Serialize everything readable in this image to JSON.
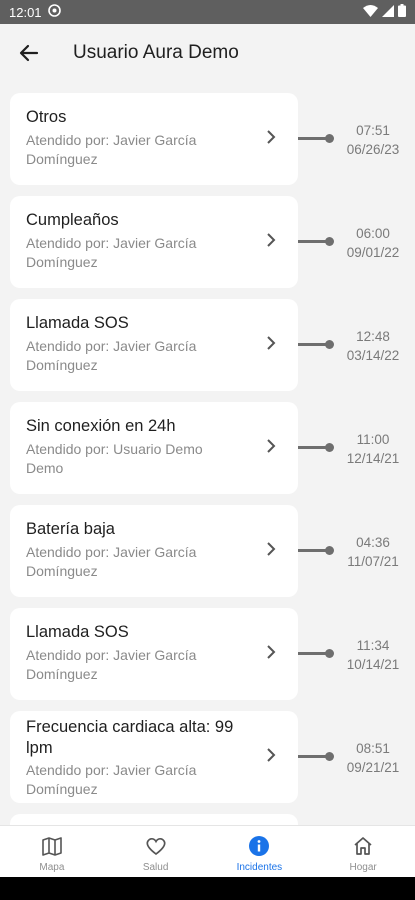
{
  "status": {
    "time": "12:01"
  },
  "header": {
    "title": "Usuario Aura Demo"
  },
  "incidents": [
    {
      "name": "Otros",
      "attended": "Atendido por: Javier García Domínguez",
      "time": "07:51",
      "date": "06/26/23"
    },
    {
      "name": "Cumpleaños",
      "attended": "Atendido por: Javier García Domínguez",
      "time": "06:00",
      "date": "09/01/22"
    },
    {
      "name": "Llamada SOS",
      "attended": "Atendido por: Javier García Domínguez",
      "time": "12:48",
      "date": "03/14/22"
    },
    {
      "name": "Sin conexión en 24h",
      "attended": "Atendido por: Usuario Demo Demo",
      "time": "11:00",
      "date": "12/14/21"
    },
    {
      "name": "Batería baja",
      "attended": "Atendido por: Javier García Domínguez",
      "time": "04:36",
      "date": "11/07/21"
    },
    {
      "name": "Llamada SOS",
      "attended": "Atendido por: Javier García Domínguez",
      "time": "11:34",
      "date": "10/14/21"
    },
    {
      "name": "Frecuencia cardiaca alta: 99 lpm",
      "attended": "Atendido por: Javier García Domínguez",
      "time": "08:51",
      "date": "09/21/21"
    }
  ],
  "nav": {
    "mapa": "Mapa",
    "salud": "Salud",
    "incidentes": "Incidentes",
    "hogar": "Hogar",
    "active_color": "#1a73e8"
  }
}
